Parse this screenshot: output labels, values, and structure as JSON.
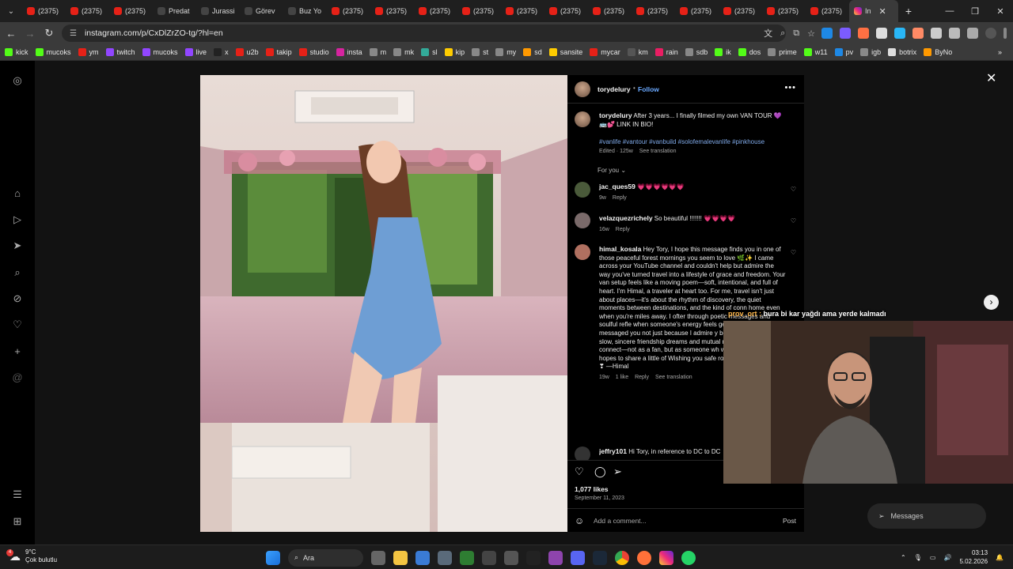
{
  "browser": {
    "tabs": [
      {
        "label": "(2375)",
        "color": "#e62117"
      },
      {
        "label": "(2375)",
        "color": "#e62117"
      },
      {
        "label": "(2375)",
        "color": "#e62117"
      },
      {
        "label": "Predat",
        "color": "#444"
      },
      {
        "label": "Jurassi",
        "color": "#444"
      },
      {
        "label": "Görev",
        "color": "#444"
      },
      {
        "label": "Buz Yo",
        "color": "#444"
      },
      {
        "label": "(2375)",
        "color": "#e62117"
      },
      {
        "label": "(2375)",
        "color": "#e62117"
      },
      {
        "label": "(2375)",
        "color": "#e62117"
      },
      {
        "label": "(2375)",
        "color": "#e62117"
      },
      {
        "label": "(2375)",
        "color": "#e62117"
      },
      {
        "label": "(2375)",
        "color": "#e62117"
      },
      {
        "label": "(2375)",
        "color": "#e62117"
      },
      {
        "label": "(2375)",
        "color": "#e62117"
      },
      {
        "label": "(2375)",
        "color": "#e62117"
      },
      {
        "label": "(2375)",
        "color": "#e62117"
      },
      {
        "label": "(2375)",
        "color": "#e62117"
      },
      {
        "label": "(2375)",
        "color": "#e62117"
      }
    ],
    "active_tab": "In",
    "url": "instagram.com/p/CxDlZrZO-tg/?hl=en"
  },
  "bookmarks": [
    {
      "label": "kick",
      "color": "#53fc18"
    },
    {
      "label": "mucoks",
      "color": "#53fc18"
    },
    {
      "label": "ym",
      "color": "#e62117"
    },
    {
      "label": "twitch",
      "color": "#9146ff"
    },
    {
      "label": "mucoks",
      "color": "#9146ff"
    },
    {
      "label": "live",
      "color": "#9146ff"
    },
    {
      "label": "x",
      "color": "#222"
    },
    {
      "label": "u2b",
      "color": "#e62117"
    },
    {
      "label": "takip",
      "color": "#e62117"
    },
    {
      "label": "studio",
      "color": "#e62117"
    },
    {
      "label": "insta",
      "color": "#d6249f"
    },
    {
      "label": "m",
      "color": "#888"
    },
    {
      "label": "mk",
      "color": "#888"
    },
    {
      "label": "sl",
      "color": "#3a9"
    },
    {
      "label": "kip",
      "color": "#fc0"
    },
    {
      "label": "st",
      "color": "#888"
    },
    {
      "label": "my",
      "color": "#888"
    },
    {
      "label": "sd",
      "color": "#f90"
    },
    {
      "label": "sansite",
      "color": "#fc0"
    },
    {
      "label": "mycar",
      "color": "#e62117"
    },
    {
      "label": "km",
      "color": "#555"
    },
    {
      "label": "rain",
      "color": "#e91e63"
    },
    {
      "label": "sdb",
      "color": "#888"
    },
    {
      "label": "ik",
      "color": "#53fc18"
    },
    {
      "label": "dos",
      "color": "#53fc18"
    },
    {
      "label": "prime",
      "color": "#888"
    },
    {
      "label": "w11",
      "color": "#53fc18"
    },
    {
      "label": "pv",
      "color": "#1e88e5"
    },
    {
      "label": "igb",
      "color": "#888"
    },
    {
      "label": "botrix",
      "color": "#ddd"
    },
    {
      "label": "ByNo",
      "color": "#f90"
    }
  ],
  "post": {
    "username": "torydelury",
    "follow_label": "Follow",
    "caption": "After 3 years... I finally filmed my own VAN TOUR 💜🚌💕 LINK IN BIO!",
    "hashtags": "#vanlife #vantour #vanbuild #solofemalevanlife #pinkhouse",
    "edited_meta": "Edited · 125w",
    "see_translation": "See translation",
    "for_you": "For you",
    "likes": "1,077 likes",
    "date": "September 11, 2023",
    "add_comment_placeholder": "Add a comment...",
    "post_label": "Post"
  },
  "comments": [
    {
      "user": "jac_ques59",
      "text": "💗💗💗💗💗💗",
      "meta": "9w",
      "reply": "Reply",
      "avatar": "#4a5a3a"
    },
    {
      "user": "velazquezrichely",
      "text": "So beautiful !!!!!!! 💗💗💗💗",
      "meta": "16w",
      "reply": "Reply",
      "avatar": "#7a6a6a"
    },
    {
      "user": "himal_kosala",
      "text": "Hey Tory, I hope this message finds you in one of those peaceful forest mornings you seem to love 🌿✨ I came across your YouTube channel and couldn't help but admire the way you've turned travel into a lifestyle of grace and freedom. Your van setup feels like a moving poem—soft, intentional, and full of heart. I'm Himal, a traveler at heart too. For me, travel isn't just about places—it's about the rhythm of discovery, the quiet moments between destinations, and the kind of conn home even when you're miles away. I ofter through poetic messages and soulful refle when someone's energy feels genuine and yours. I messaged you not just because I admire y because I believe in slow, sincere friendship dreams and mutual respect. If you're open connect—not as a fan, but as someone wh way you live and hopes to share a little of Wishing you safe roads and soft sunsets ❣ —Himal",
      "meta": "19w",
      "likes": "1 like",
      "reply": "Reply",
      "translate": "See translation",
      "avatar": "#b07060"
    },
    {
      "user": "jeffry101",
      "text": "Hi Tory, in reference to DC to DC",
      "avatar": "#333"
    }
  ],
  "stream": {
    "chat_user": "prov_ort :",
    "chat_text": "bura bi kar yağdı ama yerde kalmadı"
  },
  "messages_label": "Messages",
  "taskbar": {
    "temp": "9°C",
    "weather": "Çok bulutlu",
    "search": "Ara",
    "time": "03:13",
    "date": "5.02.2026",
    "badge": "4"
  }
}
